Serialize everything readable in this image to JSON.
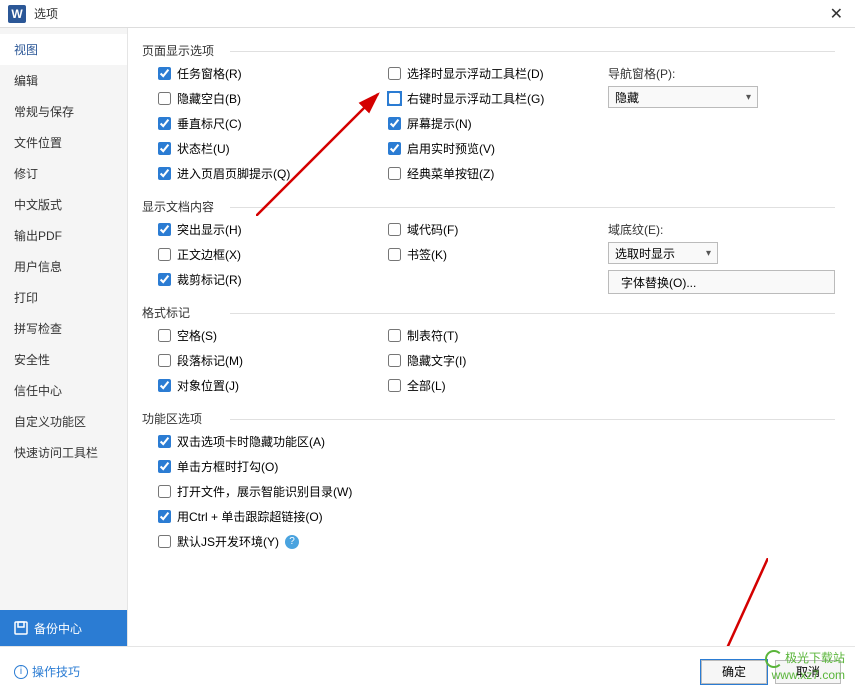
{
  "titlebar": {
    "app_initial": "W",
    "title": "选项"
  },
  "sidebar": {
    "items": [
      "视图",
      "编辑",
      "常规与保存",
      "文件位置",
      "修订",
      "中文版式",
      "输出PDF",
      "用户信息",
      "打印",
      "拼写检查",
      "安全性",
      "信任中心",
      "自定义功能区",
      "快速访问工具栏"
    ],
    "backup_label": "备份中心"
  },
  "content": {
    "sec1": {
      "title": "页面显示选项",
      "left": [
        "任务窗格(R)",
        "隐藏空白(B)",
        "垂直标尺(C)",
        "状态栏(U)",
        "进入页眉页脚提示(Q)"
      ],
      "mid": [
        "选择时显示浮动工具栏(D)",
        "右键时显示浮动工具栏(G)",
        "屏幕提示(N)",
        "启用实时预览(V)",
        "经典菜单按钮(Z)"
      ],
      "right": {
        "label": "导航窗格(P):",
        "value": "隐藏"
      }
    },
    "sec2": {
      "title": "显示文档内容",
      "left": [
        "突出显示(H)",
        "正文边框(X)",
        "裁剪标记(R)"
      ],
      "mid": [
        "域代码(F)",
        "书签(K)"
      ],
      "right": {
        "label": "域底纹(E):",
        "value": "选取时显示",
        "btn": "字体替换(O)..."
      }
    },
    "sec3": {
      "title": "格式标记",
      "left": [
        "空格(S)",
        "段落标记(M)",
        "对象位置(J)"
      ],
      "mid": [
        "制表符(T)",
        "隐藏文字(I)",
        "全部(L)"
      ]
    },
    "sec4": {
      "title": "功能区选项",
      "items": [
        "双击选项卡时隐藏功能区(A)",
        "单击方框时打勾(O)",
        "打开文件，展示智能识别目录(W)",
        "用Ctrl + 单击跟踪超链接(O)",
        "默认JS开发环境(Y)"
      ]
    }
  },
  "footer": {
    "tips": "操作技巧",
    "ok": "确定",
    "cancel": "取消"
  },
  "watermark": {
    "name": "极光下载站",
    "url": "www.xz7.com"
  }
}
